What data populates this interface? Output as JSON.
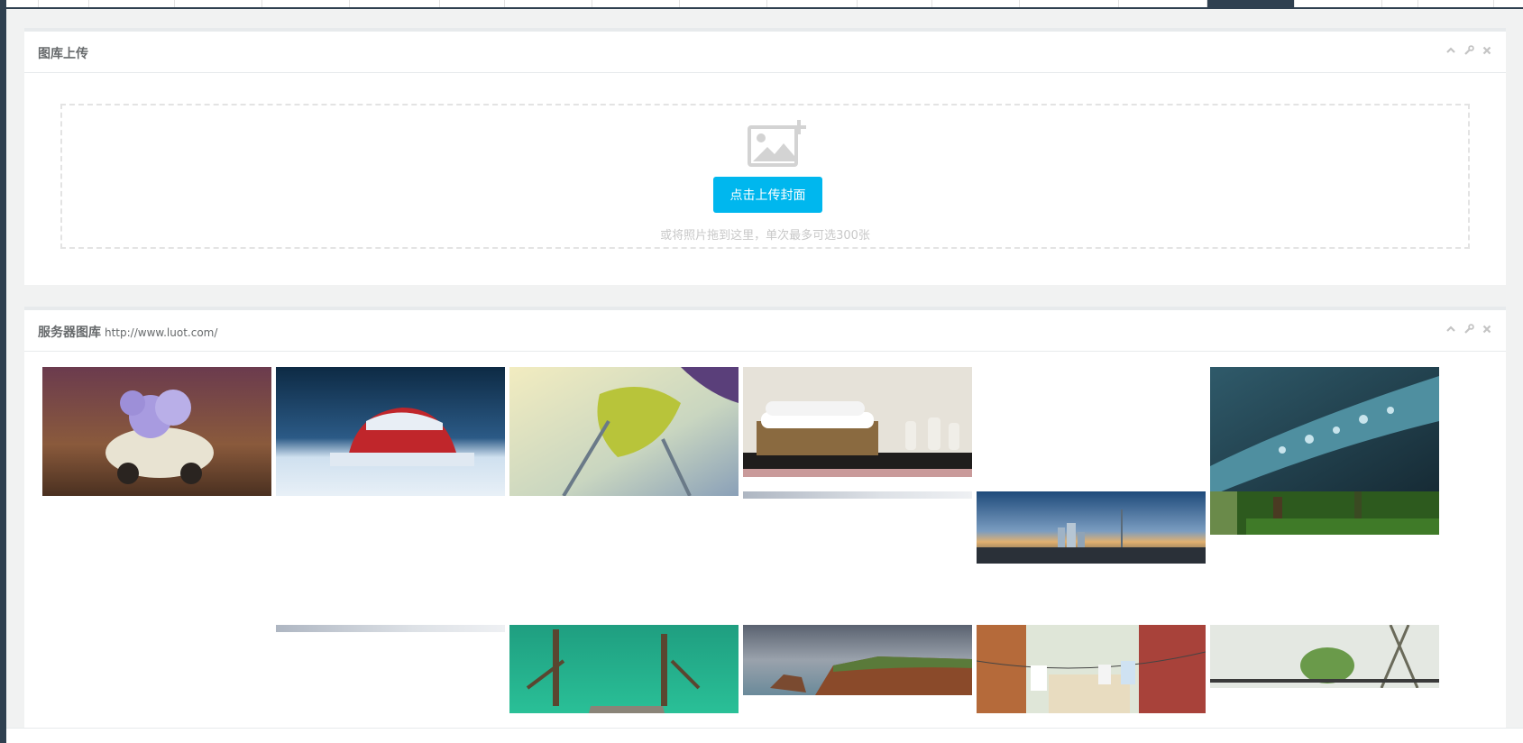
{
  "upload_panel": {
    "title": "图库上传",
    "button_label": "点击上传封面",
    "hint": "或将照片拖到这里，单次最多可选300张"
  },
  "gallery_panel": {
    "title": "服务器图库",
    "url": "http://www.luot.com/"
  },
  "colors": {
    "accent": "#00b7ee",
    "sidebar": "#2f4050"
  },
  "icons": [
    "chevron-up-icon",
    "wrench-icon",
    "close-icon",
    "image-add-icon"
  ]
}
